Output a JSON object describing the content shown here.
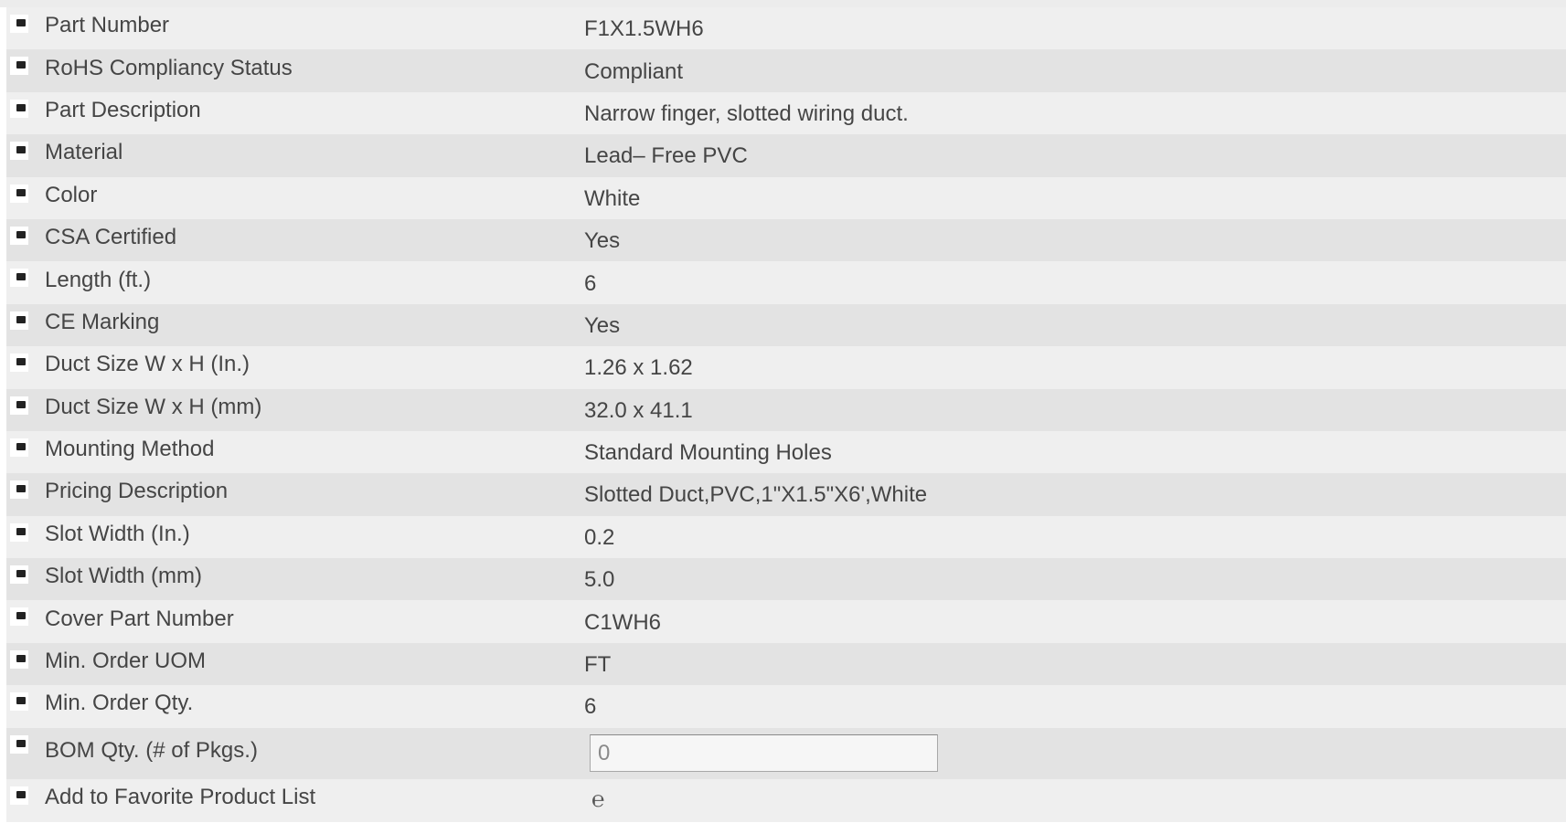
{
  "rows": [
    {
      "label": "Part Number",
      "value": "F1X1.5WH6"
    },
    {
      "label": "RoHS Compliancy Status",
      "value": "Compliant"
    },
    {
      "label": "Part Description",
      "value": "Narrow finger, slotted wiring duct."
    },
    {
      "label": "Material",
      "value": "Lead– Free PVC"
    },
    {
      "label": "Color",
      "value": "White"
    },
    {
      "label": "CSA Certified",
      "value": "Yes"
    },
    {
      "label": "Length (ft.)",
      "value": "6"
    },
    {
      "label": "CE Marking",
      "value": "Yes"
    },
    {
      "label": "Duct Size W x H (In.)",
      "value": "1.26 x 1.62"
    },
    {
      "label": "Duct Size W x H (mm)",
      "value": "32.0 x 41.1"
    },
    {
      "label": "Mounting Method",
      "value": "Standard Mounting Holes"
    },
    {
      "label": "Pricing Description",
      "value": "Slotted Duct,PVC,1\"X1.5\"X6',White"
    },
    {
      "label": "Slot Width (In.)",
      "value": "0.2"
    },
    {
      "label": "Slot Width (mm)",
      "value": "5.0"
    },
    {
      "label": "Cover Part Number",
      "value": "C1WH6"
    },
    {
      "label": "Min. Order UOM",
      "value": "FT"
    },
    {
      "label": "Min. Order Qty.",
      "value": "6"
    }
  ],
  "bom_qty": {
    "label": "BOM Qty. (# of Pkgs.)",
    "value": "0"
  },
  "favorite": {
    "label": "Add to Favorite Product List",
    "icon": "favorite-icon",
    "glyph": "℮"
  }
}
